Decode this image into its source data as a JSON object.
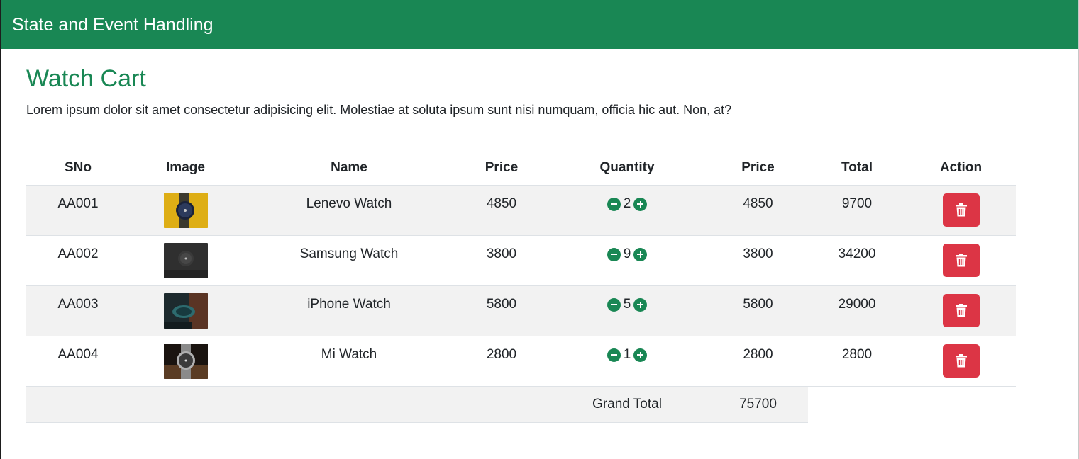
{
  "navbar": {
    "brand": "State and Event Handling"
  },
  "page": {
    "title": "Watch Cart",
    "description": "Lorem ipsum dolor sit amet consectetur adipisicing elit. Molestiae at soluta ipsum sunt nisi numquam, officia hic aut. Non, at?"
  },
  "table": {
    "headers": [
      "SNo",
      "Image",
      "Name",
      "Price",
      "Quantity",
      "Price",
      "Total",
      "Action"
    ],
    "rows": [
      {
        "sno": "AA001",
        "name": "Lenevo Watch",
        "price": "4850",
        "qty": "2",
        "unit_price": "4850",
        "total": "9700"
      },
      {
        "sno": "AA002",
        "name": "Samsung Watch",
        "price": "3800",
        "qty": "9",
        "unit_price": "3800",
        "total": "34200"
      },
      {
        "sno": "AA003",
        "name": "iPhone Watch",
        "price": "5800",
        "qty": "5",
        "unit_price": "5800",
        "total": "29000"
      },
      {
        "sno": "AA004",
        "name": "Mi Watch",
        "price": "2800",
        "qty": "1",
        "unit_price": "2800",
        "total": "2800"
      }
    ],
    "grand_total_label": "Grand Total",
    "grand_total_value": "75700"
  },
  "colors": {
    "brand": "#198754",
    "danger": "#dc3545",
    "row_stripe": "#f2f2f2"
  },
  "icons": {
    "minus": "dash-circle-fill-icon",
    "plus": "plus-circle-fill-icon",
    "delete": "trash-icon"
  }
}
